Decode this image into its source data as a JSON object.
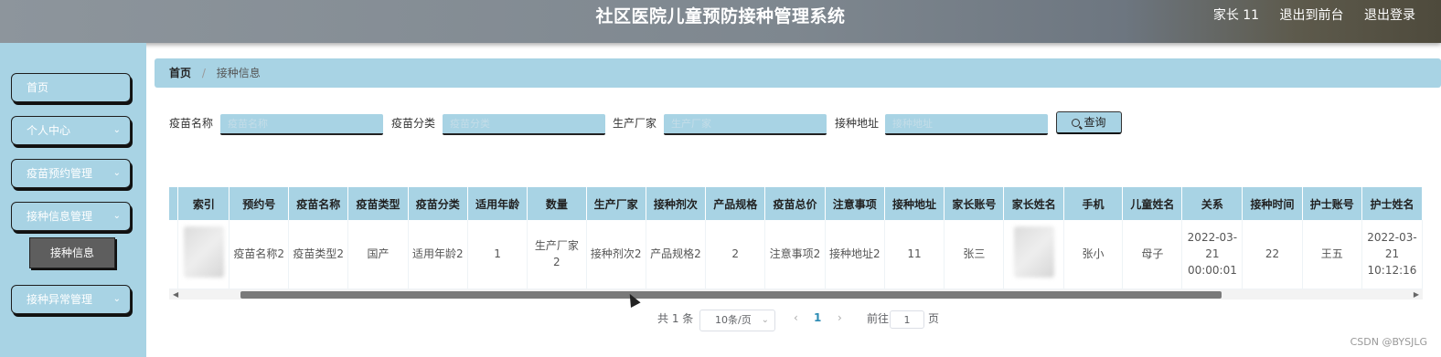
{
  "header": {
    "title": "社区医院儿童预防接种管理系统",
    "user": "家长 11",
    "back_to_front": "退出到前台",
    "logout": "退出登录"
  },
  "sidebar": {
    "items": [
      {
        "label": "首页",
        "has_children": false
      },
      {
        "label": "个人中心",
        "has_children": true
      },
      {
        "label": "疫苗预约管理",
        "has_children": true
      },
      {
        "label": "接种信息管理",
        "has_children": true,
        "expanded": true
      },
      {
        "label": "接种异常管理",
        "has_children": true
      }
    ],
    "sub_item": "接种信息"
  },
  "breadcrumb": {
    "home": "首页",
    "current": "接种信息"
  },
  "search": {
    "fields": [
      {
        "label": "疫苗名称",
        "placeholder": "疫苗名称"
      },
      {
        "label": "疫苗分类",
        "placeholder": "疫苗分类"
      },
      {
        "label": "生产厂家",
        "placeholder": "生产厂家"
      },
      {
        "label": "接种地址",
        "placeholder": "接种地址"
      }
    ],
    "button": "查询"
  },
  "table": {
    "columns": [
      "索引",
      "预约号",
      "疫苗名称",
      "疫苗类型",
      "疫苗分类",
      "适用年龄",
      "数量",
      "生产厂家",
      "接种剂次",
      "产品规格",
      "疫苗总价",
      "注意事项",
      "接种地址",
      "家长账号",
      "家长姓名",
      "手机",
      "儿童姓名",
      "关系",
      "接种时间",
      "护士账号",
      "护士姓名"
    ],
    "rows": [
      [
        "",
        "疫苗名称2",
        "疫苗类型2",
        "国产",
        "适用年龄2",
        "1",
        "生产厂家2",
        "接种剂次2",
        "产品规格2",
        "2",
        "注意事项2",
        "接种地址2",
        "11",
        "张三",
        "",
        "张小",
        "母子",
        "2022-03-21 00:00:01",
        "22",
        "王五",
        "2022-03-21 10:12:16"
      ]
    ]
  },
  "pagination": {
    "total": "共 1 条",
    "page_size": "10条/页",
    "current_page": "1",
    "goto_label": "前往",
    "goto_value": "1",
    "page_suffix": "页",
    "prev": "‹",
    "next": "›"
  },
  "watermark": "CSDN @BYSJLG",
  "colors": {
    "accent": "#a8d3e4",
    "header": "#7e878f",
    "active_sub": "#5e5e5e",
    "current_page": "#2d8cb4"
  }
}
